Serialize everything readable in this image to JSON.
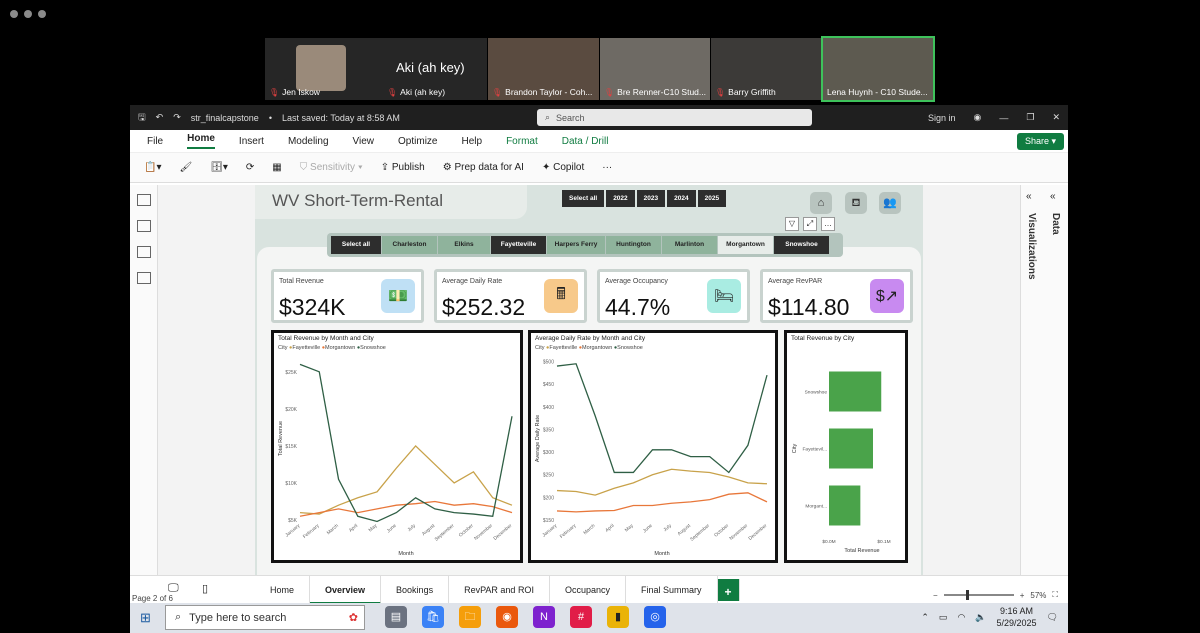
{
  "meeting": {
    "participants": [
      {
        "name": "Jen Iskow"
      },
      {
        "name": "Aki (ah key)"
      },
      {
        "name": "Brandon Taylor - Coh..."
      },
      {
        "name": "Bre Renner-C10 Stud..."
      },
      {
        "name": "Barry Griffith"
      },
      {
        "name": "Lena Huynh - C10 Stude..."
      }
    ],
    "big_name": "Aki (ah key)"
  },
  "titlebar": {
    "filename": "str_finalcapstone",
    "saved": "Last saved: Today at 8:58 AM",
    "search": "Search",
    "signin": "Sign in"
  },
  "menu": {
    "items": [
      "File",
      "Home",
      "Insert",
      "Modeling",
      "View",
      "Optimize",
      "Help"
    ],
    "context": [
      "Format",
      "Data / Drill"
    ],
    "share": "Share"
  },
  "ribbon": {
    "sensitivity": "Sensitivity",
    "publish": "Publish",
    "prep": "Prep data for AI",
    "copilot": "Copilot",
    "more": "···"
  },
  "panes": {
    "visualizations": "Visualizations",
    "data": "Data"
  },
  "report": {
    "title": "WV Short-Term-Rental",
    "years": [
      "Select all",
      "2022",
      "2023",
      "2024",
      "2025"
    ],
    "cities": [
      "Select all",
      "Charleston",
      "Elkins",
      "Fayetteville",
      "Harpers Ferry",
      "Huntington",
      "Marlinton",
      "Morgantown",
      "Snowshoe"
    ]
  },
  "kpis": [
    {
      "label": "Total Revenue",
      "value": "$324K",
      "icon": "money-icon",
      "color": "#bfe0f5"
    },
    {
      "label": "Average Daily Rate",
      "value": "$252.32",
      "icon": "register-icon",
      "color": "#f7c98a"
    },
    {
      "label": "Average Occupancy",
      "value": "44.7%",
      "icon": "bed-icon",
      "color": "#a9ece2"
    },
    {
      "label": "Average RevPAR",
      "value": "$114.80",
      "icon": "growth-icon",
      "color": "#c88af0"
    }
  ],
  "chart_data": [
    {
      "type": "line",
      "title": "Total Revenue by Month and City",
      "legend_title": "City",
      "xlabel": "Month",
      "ylabel": "Total Revenue",
      "y_ticks": [
        "$5K",
        "$10K",
        "$15K",
        "$20K",
        "$25K"
      ],
      "ylim": [
        5,
        27
      ],
      "categories": [
        "January",
        "February",
        "March",
        "April",
        "May",
        "June",
        "July",
        "August",
        "September",
        "October",
        "November",
        "December"
      ],
      "series": [
        {
          "name": "Fayetteville",
          "color": "#c8a24a",
          "values": [
            6,
            5.8,
            7,
            8,
            8.8,
            12,
            15,
            12.5,
            10,
            11.5,
            8,
            7
          ]
        },
        {
          "name": "Morgantown",
          "color": "#e8773a",
          "values": [
            5.5,
            6,
            6.5,
            6,
            6.5,
            7,
            7.2,
            7.5,
            7,
            7.2,
            6.8,
            6
          ]
        },
        {
          "name": "Snowshoe",
          "color": "#2f5f45",
          "values": [
            26,
            25,
            10.5,
            5.5,
            4.8,
            6,
            8,
            6.5,
            6,
            5.8,
            5.5,
            19
          ]
        }
      ]
    },
    {
      "type": "line",
      "title": "Average Daily Rate by Month and City",
      "legend_title": "City",
      "xlabel": "Month",
      "ylabel": "Average Daily Rate",
      "y_ticks": [
        "$150",
        "$200",
        "$250",
        "$300",
        "$350",
        "$400",
        "$450",
        "$500"
      ],
      "ylim": [
        150,
        510
      ],
      "categories": [
        "January",
        "February",
        "March",
        "April",
        "May",
        "June",
        "July",
        "August",
        "September",
        "October",
        "November",
        "December"
      ],
      "series": [
        {
          "name": "Fayetteville",
          "color": "#c8a24a",
          "values": [
            215,
            213,
            205,
            220,
            232,
            250,
            262,
            258,
            255,
            245,
            232,
            230
          ]
        },
        {
          "name": "Morgantown",
          "color": "#e8773a",
          "values": [
            170,
            168,
            170,
            171,
            182,
            182,
            187,
            190,
            195,
            207,
            210,
            190
          ]
        },
        {
          "name": "Snowshoe",
          "color": "#2f5f45",
          "values": [
            490,
            495,
            380,
            255,
            255,
            305,
            305,
            290,
            290,
            255,
            315,
            470
          ]
        }
      ]
    },
    {
      "type": "bar",
      "orientation": "horizontal",
      "title": "Total Revenue by City",
      "xlabel": "Total Revenue",
      "ylabel": "City",
      "x_ticks": [
        "$0.0M",
        "$0.1M"
      ],
      "xlim": [
        0,
        0.12
      ],
      "bar_color": "#4aa34a",
      "categories": [
        "Snowshoe",
        "Fayettevil...",
        "Morgant..."
      ],
      "values": [
        0.095,
        0.08,
        0.057
      ]
    }
  ],
  "tabs": [
    "Home",
    "Overview",
    "Bookings",
    "RevPAR and ROI",
    "Occupancy",
    "Final Summary"
  ],
  "status": {
    "page": "Page 2 of 6",
    "zoom": "57%"
  },
  "taskbar": {
    "search": "Type here to search",
    "time": "9:16 AM",
    "date": "5/29/2025"
  }
}
